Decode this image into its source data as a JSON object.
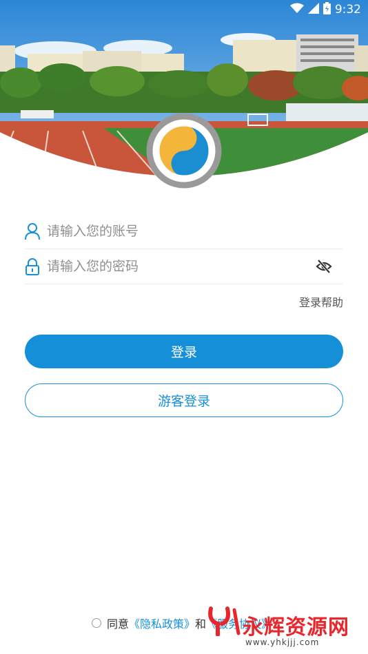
{
  "status_bar": {
    "time": "9:32"
  },
  "colors": {
    "accent": "#1590d8",
    "watermark": "#e8262b"
  },
  "login": {
    "account_placeholder": "请输入您的账号",
    "password_placeholder": "请输入您的密码",
    "help_label": "登录帮助",
    "login_button": "登录",
    "guest_button": "游客登录"
  },
  "agreement": {
    "prefix": "同意",
    "privacy_link": "《隐私政策》",
    "conjunction": "和",
    "service_link": "《服务协议》"
  },
  "watermark": {
    "brand": "永辉资源网",
    "url": "www.yhkjjj.com"
  },
  "icons": {
    "account": "user-icon",
    "password": "lock-icon",
    "visibility": "eye-off-icon"
  }
}
